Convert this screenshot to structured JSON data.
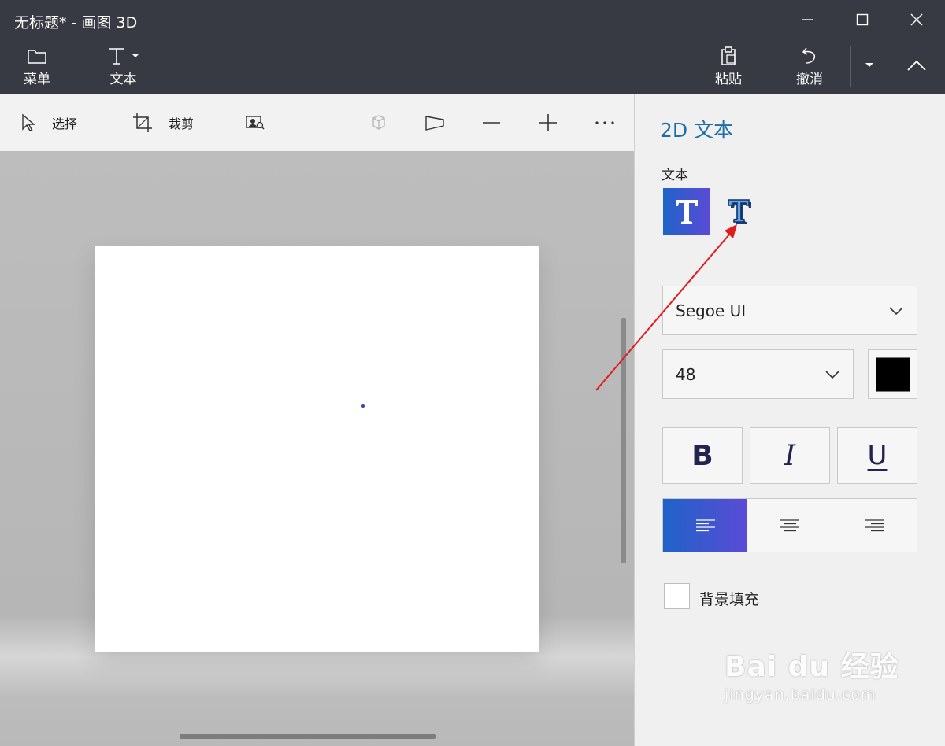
{
  "window": {
    "title": "无标题* - 画图 3D"
  },
  "ribbon": {
    "menu_label": "菜单",
    "text_label": "文本",
    "paste_label": "粘贴",
    "undo_label": "撤消"
  },
  "toolbar": {
    "select_label": "选择",
    "crop_label": "裁剪"
  },
  "panel": {
    "title": "2D 文本",
    "text_section_label": "文本",
    "font_family": "Segoe UI",
    "font_size": "48",
    "text_color": "#000000",
    "bold_label": "B",
    "italic_label": "I",
    "underline_label": "U",
    "background_fill_label": "背景填充",
    "background_fill_checked": false,
    "alignment_selected": "left"
  },
  "watermark": {
    "main": "Bai du 经验",
    "sub": "jingyan.baidu.com"
  },
  "colors": {
    "titlebar": "#373a43",
    "accent_gradient_start": "#1f63c8",
    "accent_gradient_end": "#5b4bd6",
    "panel_title": "#1e6fa8",
    "annotation_arrow": "#e01b1b"
  }
}
